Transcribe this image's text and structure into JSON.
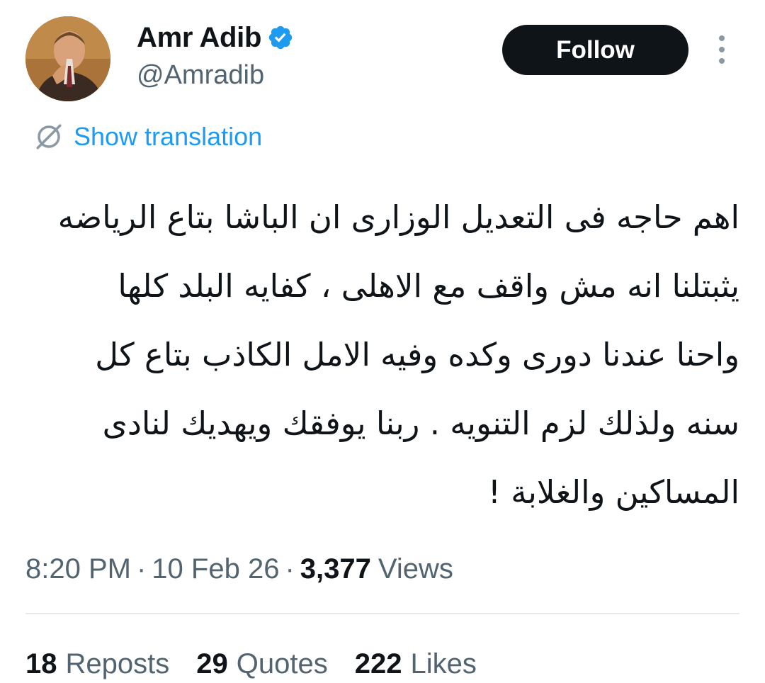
{
  "author": {
    "name": "Amr Adib",
    "handle": "@Amradib",
    "verified": true
  },
  "actions": {
    "follow_label": "Follow"
  },
  "translation": {
    "label": "Show translation"
  },
  "tweet": {
    "lines": [
      "اهم حاجه فى التعديل الوزارى ان الباشا بتاع الرياضه",
      "يثبتلنا انه مش واقف مع الاهلى ، كفايه البلد كلها",
      "واحنا عندنا دورى وكده وفيه الامل الكاذب بتاع كل",
      "سنه ولذلك لزم التنويه  . ربنا يوفقك ويهديك لنادى",
      "المساكين والغلابة !"
    ]
  },
  "meta": {
    "time": "8:20 PM",
    "separator": "·",
    "date": "10 Feb 26",
    "views_count": "3,377",
    "views_label": "Views"
  },
  "stats": [
    {
      "count": "18",
      "label": "Reposts"
    },
    {
      "count": "29",
      "label": "Quotes"
    },
    {
      "count": "222",
      "label": "Likes"
    }
  ],
  "colors": {
    "accent": "#1d9bf0",
    "text_primary": "#0f1419",
    "text_secondary": "#536471",
    "button_bg": "#0f1419"
  },
  "icons": {
    "verified": "verified-badge-icon",
    "more": "more-vertical-icon",
    "translate": "translate-icon"
  }
}
